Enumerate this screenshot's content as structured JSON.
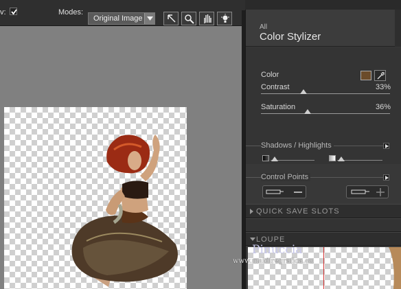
{
  "toolbar": {
    "preview_label": "v:",
    "preview_checked": true,
    "modes_label": "Modes:",
    "mode_value": "Original Image",
    "tools": [
      "arrow-icon",
      "zoom-icon",
      "hand-icon",
      "bulb-icon"
    ]
  },
  "panel": {
    "category": "All",
    "filter_title": "Color Stylizer",
    "color_label": "Color",
    "color_value": "#6b4b2a",
    "contrast_label": "Contrast",
    "contrast_value": "33%",
    "contrast_level": 0.33,
    "saturation_label": "Saturation",
    "saturation_value": "36%",
    "saturation_level": 0.36,
    "shadows_label": "Shadows / Highlights",
    "control_points_label": "Control Points",
    "quick_save_label": "QUICK SAVE SLOTS",
    "loupe_label": "LOUPE"
  },
  "watermark": {
    "name": "Pinuccia",
    "url": "www.maidiregrafica.eu"
  },
  "colors": {
    "accent_red": "#d23030",
    "panel_bg": "#343434",
    "canvas_bg": "#808080"
  }
}
